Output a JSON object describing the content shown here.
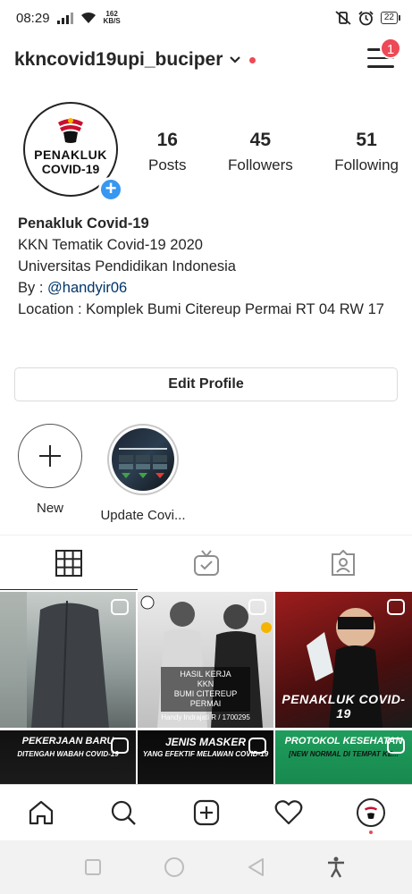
{
  "status_bar": {
    "time": "08:29",
    "net_speed_value": "162",
    "net_speed_unit": "KB/S",
    "battery": "22"
  },
  "profile": {
    "username": "kkncovid19upi_buciper",
    "notification_count": "1",
    "avatar_text_line1": "PENAKLUK",
    "avatar_text_line2": "COVID-19",
    "stats": [
      {
        "value": "16",
        "label": "Posts"
      },
      {
        "value": "45",
        "label": "Followers"
      },
      {
        "value": "51",
        "label": "Following"
      }
    ],
    "bio": {
      "name": "Penakluk Covid-19",
      "line1": "KKN Tematik Covid-19 2020",
      "line2": "Universitas Pendidikan Indonesia",
      "by_prefix": "By : ",
      "by_handle": "@handyir06",
      "location": "Location : Komplek Bumi Citereup Permai  RT 04 RW 17"
    },
    "edit_profile_label": "Edit Profile"
  },
  "highlights": [
    {
      "label": "New"
    },
    {
      "label": "Update Covi..."
    }
  ],
  "tabs": [
    "grid-icon",
    "igtv-icon",
    "tagged-icon"
  ],
  "posts": [
    {
      "caption": ""
    },
    {
      "caption_top": "HASIL KERJA",
      "caption_mid": "KKN",
      "caption_bottom": "BUMI CITEREUP PERMAI",
      "credit": "Handy Indrajati R / 1700295"
    },
    {
      "caption": "PENAKLUK COVID-19"
    },
    {
      "caption": "PEKERJAAN BARU",
      "subcaption": "DITENGAH WABAH COVID-19"
    },
    {
      "caption": "JENIS MASKER",
      "subcaption": "YANG EFEKTIF MELAWAN COVID-19"
    },
    {
      "caption": "PROTOKOL KESEHATAN",
      "subcaption": "[NEW NORMAL DI TEMPAT KE..."
    }
  ],
  "bottom_nav": [
    "home-icon",
    "search-icon",
    "new-post-icon",
    "activity-icon",
    "profile-avatar"
  ],
  "colors": {
    "accent_blue": "#3897f0",
    "badge_red": "#ed4956",
    "link": "#003569",
    "text": "#262626"
  }
}
